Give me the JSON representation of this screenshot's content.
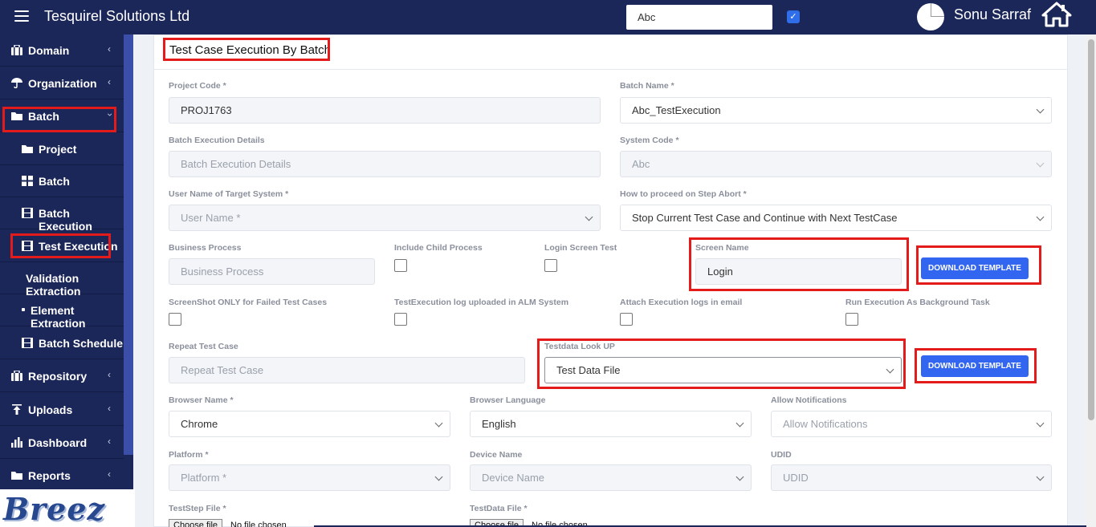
{
  "topbar": {
    "title": "Tesquirel Solutions Ltd",
    "search_value": "Abc",
    "user_name": "Sonu Sarraf"
  },
  "sidebar": {
    "items": [
      {
        "label": "Domain",
        "icon": "briefcase-icon"
      },
      {
        "label": "Organization",
        "icon": "umbrella-icon"
      },
      {
        "label": "Batch",
        "icon": "folder-icon"
      },
      {
        "label": "Project",
        "icon": "folder-icon"
      },
      {
        "label": "Batch",
        "icon": "grid-icon"
      },
      {
        "label": "Batch Execution",
        "icon": "film-icon"
      },
      {
        "label": "Test Execution",
        "icon": "film-icon"
      },
      {
        "label": "Validation Extraction",
        "icon": ""
      },
      {
        "label": "Element Extraction",
        "icon": "bullet-icon"
      },
      {
        "label": "Batch Schedule",
        "icon": "film-icon"
      },
      {
        "label": "Repository",
        "icon": "briefcase-icon"
      },
      {
        "label": "Uploads",
        "icon": "upload-icon"
      },
      {
        "label": "Dashboard",
        "icon": "bar-chart-icon"
      },
      {
        "label": "Reports",
        "icon": "folder-icon"
      }
    ],
    "logo_text": "Breez"
  },
  "form": {
    "title": "Test Case Execution By Batch",
    "project_code": {
      "label": "Project Code *",
      "value": "PROJ1763"
    },
    "batch_name": {
      "label": "Batch Name *",
      "value": "Abc_TestExecution"
    },
    "batch_execution_details": {
      "label": "Batch Execution Details",
      "placeholder": "Batch Execution Details"
    },
    "system_code": {
      "label": "System Code *",
      "value": "Abc"
    },
    "user_name_target": {
      "label": "User Name of Target System *",
      "placeholder": "User Name *"
    },
    "step_abort": {
      "label": "How to proceed on Step Abort *",
      "value": "Stop Current Test Case and Continue with Next TestCase"
    },
    "business_process": {
      "label": "Business Process",
      "placeholder": "Business Process"
    },
    "include_child": {
      "label": "Include Child Process"
    },
    "login_screen_test": {
      "label": "Login Screen Test"
    },
    "screen_name": {
      "label": "Screen Name",
      "value": "Login"
    },
    "download_template_1": "DOWNLOAD TEMPLATE",
    "screenshot_failed": {
      "label": "ScreenShot ONLY for Failed Test Cases"
    },
    "alm_log": {
      "label": "TestExecution log uploaded in ALM System"
    },
    "attach_logs": {
      "label": "Attach Execution logs in email"
    },
    "background_task": {
      "label": "Run Execution As Background Task"
    },
    "repeat_test_case": {
      "label": "Repeat Test Case",
      "placeholder": "Repeat Test Case"
    },
    "testdata_lookup": {
      "label": "Testdata Look UP",
      "value": "Test Data File"
    },
    "download_template_2": "DOWNLOAD TEMPLATE",
    "browser_name": {
      "label": "Browser Name *",
      "value": "Chrome"
    },
    "browser_language": {
      "label": "Browser Language",
      "value": "English"
    },
    "allow_notifications": {
      "label": "Allow Notifications",
      "placeholder": "Allow Notifications"
    },
    "platform": {
      "label": "Platform *",
      "placeholder": "Platform *"
    },
    "device_name": {
      "label": "Device Name",
      "placeholder": "Device Name"
    },
    "udid": {
      "label": "UDID",
      "placeholder": "UDID"
    },
    "teststep_file": {
      "label": "TestStep File *",
      "button": "Choose file",
      "status": "No file chosen"
    },
    "testdata_file": {
      "label": "TestData File *",
      "button": "Choose file",
      "status": "No file chosen"
    }
  },
  "colors": {
    "navy": "#1c2759",
    "accent_blue": "#3366f0",
    "highlight_red": "#e41b1b"
  }
}
